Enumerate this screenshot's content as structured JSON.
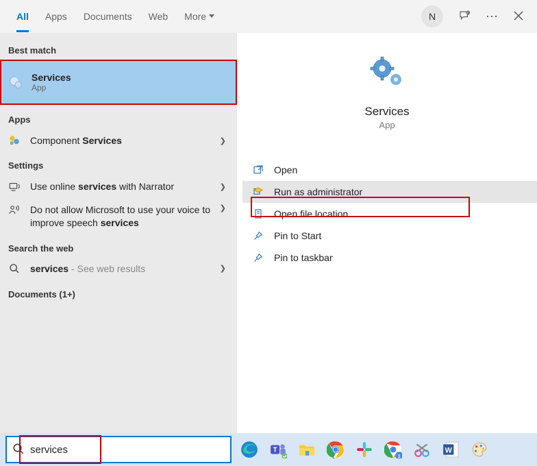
{
  "tabs": {
    "all": "All",
    "apps": "Apps",
    "documents": "Documents",
    "web": "Web",
    "more": "More"
  },
  "avatar_initial": "N",
  "sections": {
    "best_match": "Best match",
    "apps": "Apps",
    "settings": "Settings",
    "search_web": "Search the web",
    "documents": "Documents (1+)"
  },
  "results": {
    "services": {
      "title": "Services",
      "sub": "App"
    },
    "component_services": {
      "prefix": "Component ",
      "bold": "Services"
    },
    "narrator": {
      "p1": "Use online ",
      "b1": "services",
      "p2": " with Narrator"
    },
    "speech": {
      "p1": "Do not allow Microsoft to use your voice to improve speech ",
      "b1": "services"
    },
    "web": {
      "b1": "services",
      "p2": " - See web results"
    }
  },
  "hero": {
    "title": "Services",
    "sub": "App"
  },
  "actions": {
    "open": "Open",
    "run_admin": "Run as administrator",
    "open_loc": "Open file location",
    "pin_start": "Pin to Start",
    "pin_taskbar": "Pin to taskbar"
  },
  "search": {
    "query": "services"
  }
}
